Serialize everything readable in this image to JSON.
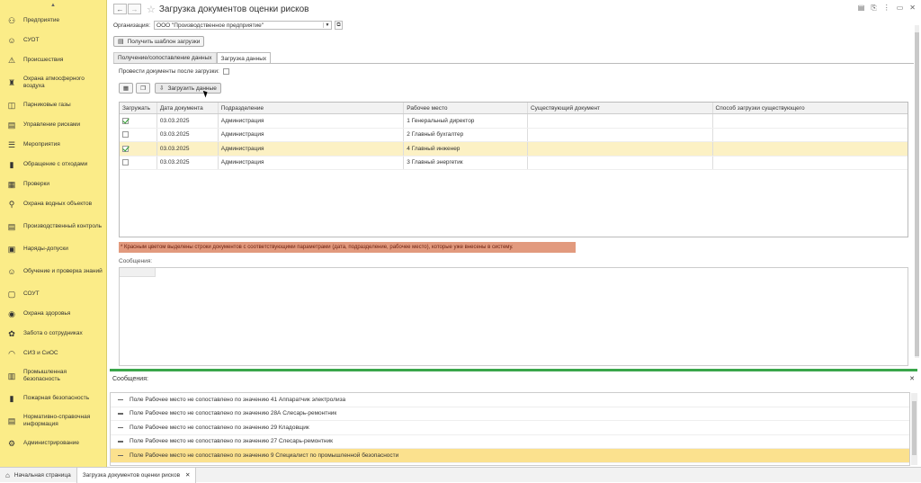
{
  "sidebar": {
    "items": [
      {
        "label": "Предприятие",
        "icon": "org-chart-icon"
      },
      {
        "label": "СУОТ",
        "icon": "people-icon"
      },
      {
        "label": "Происшествия",
        "icon": "warning-icon"
      },
      {
        "label": "Охрана атмосферного воздуха",
        "icon": "factory-icon"
      },
      {
        "label": "Парниковые газы",
        "icon": "co2-icon"
      },
      {
        "label": "Управление рисками",
        "icon": "risk-icon"
      },
      {
        "label": "Мероприятия",
        "icon": "list-icon"
      },
      {
        "label": "Обращение с отходами",
        "icon": "waste-icon"
      },
      {
        "label": "Проверки",
        "icon": "checklist-icon"
      },
      {
        "label": "Охрана водных объектов",
        "icon": "water-tap-icon"
      },
      {
        "label": "Производственный контроль",
        "icon": "document-icon"
      },
      {
        "label": "Наряды-допуски",
        "icon": "permit-icon"
      },
      {
        "label": "Обучение и проверка знаний",
        "icon": "training-icon"
      },
      {
        "label": "СОУТ",
        "icon": "assessment-icon"
      },
      {
        "label": "Охрана здоровья",
        "icon": "health-icon"
      },
      {
        "label": "Забота о сотрудниках",
        "icon": "care-icon"
      },
      {
        "label": "СИЗ и СиОС",
        "icon": "ppe-icon"
      },
      {
        "label": "Промышленная безопасность",
        "icon": "industry-icon"
      },
      {
        "label": "Пожарная безопасность",
        "icon": "fire-extinguisher-icon"
      },
      {
        "label": "Нормативно-справочная информация",
        "icon": "reference-icon"
      },
      {
        "label": "Администрирование",
        "icon": "admin-icon"
      }
    ]
  },
  "header": {
    "title": "Загрузка документов оценки рисков"
  },
  "form": {
    "org_label": "Организация:",
    "org_value": "ООО \"Производственное предприятие\"",
    "template_button": "Получить шаблон загрузки"
  },
  "tabs": [
    {
      "label": "Получение/сопоставление данных"
    },
    {
      "label": "Загрузка данных"
    }
  ],
  "upload": {
    "post_label": "Провести документы после загрузки:",
    "load_button": "Загрузить данные",
    "columns": [
      "Загружать",
      "Дата документа",
      "Подразделение",
      "Рабочее место",
      "Существующий документ",
      "Способ загрузки существующего"
    ],
    "rows": [
      {
        "checked": true,
        "date": "03.03.2025",
        "dept": "Администрация",
        "place": "1 Генеральный директор",
        "existing": "",
        "method": ""
      },
      {
        "checked": false,
        "date": "03.03.2025",
        "dept": "Администрация",
        "place": "2 Главный бухгалтер",
        "existing": "",
        "method": ""
      },
      {
        "checked": true,
        "date": "03.03.2025",
        "dept": "Администрация",
        "place": "4 Главный инженер",
        "existing": "",
        "method": ""
      },
      {
        "checked": false,
        "date": "03.03.2025",
        "dept": "Администрация",
        "place": "3 Главный энергетик",
        "existing": "",
        "method": ""
      }
    ],
    "notice": "* Красным цветом выделены строки документов с соответствующими параметрами (дата, подразделение, рабочее место), которые уже внесены в систему.",
    "messages_label": "Сообщения:"
  },
  "messages_panel": {
    "title": "Сообщения:",
    "items": [
      "Поле Рабочее место не сопоставлено по значению 41 Аппаратчик электролиза",
      "Поле Рабочее место не сопоставлено по значению 28А Слесарь-ремонтник",
      "Поле Рабочее место не сопоставлено по значению 29 Кладовщик",
      "Поле Рабочее место не сопоставлено по значению 27 Слесарь-ремонтник",
      "Поле Рабочее место не сопоставлено по значению 9 Специалист по промышленной безопасности"
    ]
  },
  "bottom": {
    "home": "Начальная страница",
    "tab": "Загрузка документов оценки рисков"
  },
  "colors": {
    "sidebar": "#fbec88",
    "selected_row": "#fcf1c4",
    "notice": "#e29a7e",
    "accent": "#3aa64a"
  }
}
